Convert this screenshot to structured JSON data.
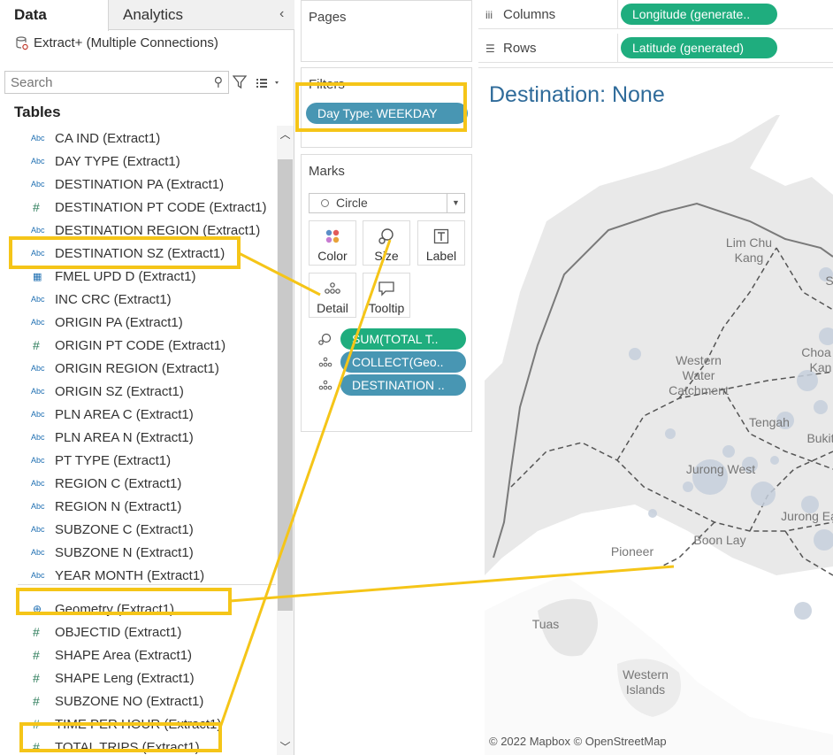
{
  "pane_tabs": {
    "data": "Data",
    "analytics": "Analytics",
    "collapse": "‹"
  },
  "data_source": {
    "name": "Extract+ (Multiple Connections)"
  },
  "search": {
    "placeholder": "Search"
  },
  "tables_title": "Tables",
  "fields": [
    {
      "type": "Abc",
      "name": "CA IND (Extract1)"
    },
    {
      "type": "Abc",
      "name": "DAY TYPE (Extract1)"
    },
    {
      "type": "Abc",
      "name": "DESTINATION PA (Extract1)"
    },
    {
      "type": "#",
      "name": "DESTINATION PT CODE (Extract1)"
    },
    {
      "type": "Abc",
      "name": "DESTINATION REGION (Extract1)"
    },
    {
      "type": "Abc",
      "name": "DESTINATION SZ (Extract1)"
    },
    {
      "type": "date",
      "name": "FMEL UPD D (Extract1)"
    },
    {
      "type": "Abc",
      "name": "INC CRC (Extract1)"
    },
    {
      "type": "Abc",
      "name": "ORIGIN PA (Extract1)"
    },
    {
      "type": "#",
      "name": "ORIGIN PT CODE (Extract1)"
    },
    {
      "type": "Abc",
      "name": "ORIGIN REGION (Extract1)"
    },
    {
      "type": "Abc",
      "name": "ORIGIN SZ (Extract1)"
    },
    {
      "type": "Abc",
      "name": "PLN AREA C (Extract1)"
    },
    {
      "type": "Abc",
      "name": "PLN AREA N (Extract1)"
    },
    {
      "type": "Abc",
      "name": "PT TYPE (Extract1)"
    },
    {
      "type": "Abc",
      "name": "REGION C (Extract1)"
    },
    {
      "type": "Abc",
      "name": "REGION N (Extract1)"
    },
    {
      "type": "Abc",
      "name": "SUBZONE C (Extract1)"
    },
    {
      "type": "Abc",
      "name": "SUBZONE N (Extract1)"
    },
    {
      "type": "Abc",
      "name": "YEAR MONTH (Extract1)"
    },
    {
      "type": "geo",
      "name": "Geometry (Extract1)"
    },
    {
      "type": "#",
      "name": "OBJECTID (Extract1)"
    },
    {
      "type": "#",
      "name": "SHAPE Area (Extract1)"
    },
    {
      "type": "#",
      "name": "SHAPE Leng (Extract1)"
    },
    {
      "type": "#",
      "name": "SUBZONE NO (Extract1)"
    },
    {
      "type": "#",
      "name": "TIME PER HOUR (Extract1)"
    },
    {
      "type": "#",
      "name": "TOTAL TRIPS (Extract1)"
    }
  ],
  "pages": {
    "title": "Pages"
  },
  "filters": {
    "title": "Filters",
    "pill": "Day Type: WEEKDAY"
  },
  "marks": {
    "title": "Marks",
    "mark_type": "Circle",
    "buttons": {
      "color": "Color",
      "size": "Size",
      "label": "Label",
      "detail": "Detail",
      "tooltip": "Tooltip"
    },
    "encodings": [
      "SUM(TOTAL T..",
      "COLLECT(Geo..",
      "DESTINATION .."
    ]
  },
  "columns": {
    "label": "Columns",
    "pill": "Longitude (generate.."
  },
  "rows": {
    "label": "Rows",
    "pill": "Latitude (generated)"
  },
  "view": {
    "title": "Destination: None"
  },
  "map": {
    "place_labels": [
      "Lim Chu\nKang",
      "Western\nWater\nCatchment",
      "Tengah",
      "Jurong West",
      "Jurong Ea",
      "Boon Lay",
      "Pioneer",
      "Tuas",
      "Western\nIslands",
      "Choa\nKan",
      "Bukit",
      "S"
    ],
    "attribution": "© 2022 Mapbox © OpenStreetMap"
  },
  "colors": {
    "pill_blue": "#4896b3",
    "pill_green": "#1fad7e",
    "title_blue": "#2f6b9a",
    "highlight": "#f5c518",
    "map_land": "#e9e9e9",
    "map_water": "#ffffff",
    "bubble": "#c5cfdc"
  }
}
